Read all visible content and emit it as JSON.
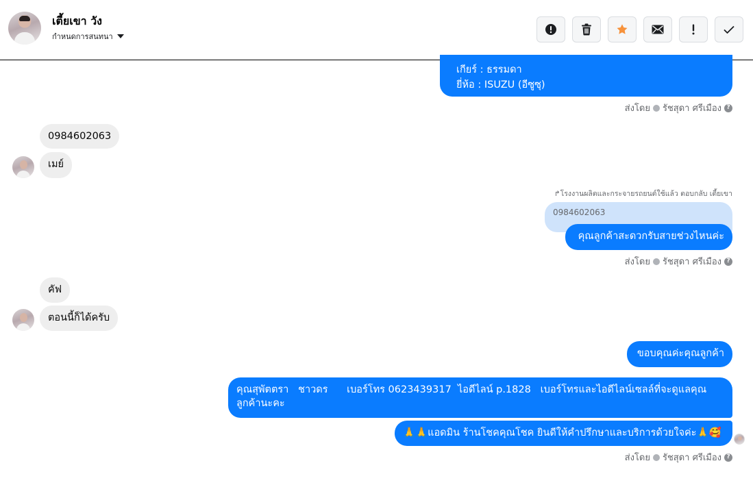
{
  "header": {
    "contact_name": "เตี้ยเขา วัง",
    "assign_label": "กำหนดการสนทนา",
    "actions": [
      {
        "name": "spam-button",
        "icon": "alert-circle-icon"
      },
      {
        "name": "delete-button",
        "icon": "trash-icon"
      },
      {
        "name": "star-button",
        "icon": "star-icon"
      },
      {
        "name": "mark-unread-button",
        "icon": "envelope-icon"
      },
      {
        "name": "follow-up-button",
        "icon": "exclamation-icon"
      },
      {
        "name": "mark-done-button",
        "icon": "check-icon"
      }
    ],
    "star_color": "#f7923b"
  },
  "messages": {
    "m1_line1": "เกียร์ : ธรรมดา",
    "m1_line2": "ยี่ห้อ : ISUZU (อีซูซุ)",
    "sent_by_prefix": "ส่งโดย",
    "sent_by_name": "รัชสุดา ศรีเมือง",
    "in1": "0984602063",
    "in2": "เมย์",
    "reply_note": "โรงงานผลิตและกระจายรถยนต์ใช้แล้ว ตอบกลับ เตี้ยเขา",
    "reply_quote": "0984602063",
    "out2": "คุณลูกค้าสะดวกรับสายช่วงไหนค่ะ",
    "in3": "คัฟ",
    "in4": "ตอนนี้ก็ได้ครับ",
    "out3": "ขอบคุณค่ะคุณลูกค้า",
    "out4": "คุณสุพัตตรา   ชาวดร      เบอร์โทร 0623439317  ไอดีไลน์ p.1828   เบอร์โทรและไอดีไลน์เซลล์ที่จะดูแลคุณลูกค้านะคะ",
    "out5": "🙏🙏แอดมิน ร้านโชคคุณโชค ยินดีให้คำปรึกษาและบริการด้วยใจค่ะ🙏🥰"
  },
  "colors": {
    "outgoing_bubble": "#0a7cff",
    "incoming_bubble": "#eeeeee",
    "reply_quote_bg": "#cfe3fb"
  }
}
